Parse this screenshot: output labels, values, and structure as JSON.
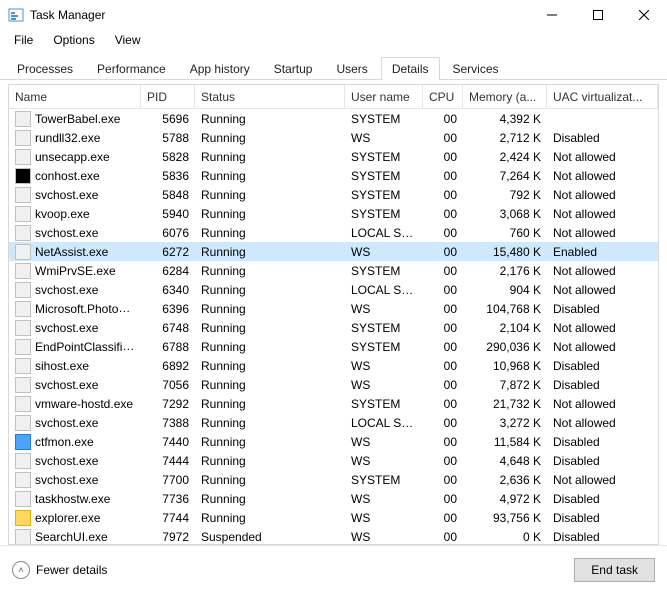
{
  "window": {
    "title": "Task Manager"
  },
  "menu": {
    "file": "File",
    "options": "Options",
    "view": "View"
  },
  "tabs": {
    "processes": "Processes",
    "performance": "Performance",
    "app_history": "App history",
    "startup": "Startup",
    "users": "Users",
    "details": "Details",
    "services": "Services"
  },
  "columns": {
    "name": "Name",
    "pid": "PID",
    "status": "Status",
    "user": "User name",
    "cpu": "CPU",
    "memory": "Memory (a...",
    "uac": "UAC virtualizat..."
  },
  "rows": [
    {
      "icon": "app",
      "name": "TowerBabel.exe",
      "pid": "5696",
      "status": "Running",
      "user": "SYSTEM",
      "cpu": "00",
      "mem": "4,392 K",
      "uac": ""
    },
    {
      "icon": "app",
      "name": "rundll32.exe",
      "pid": "5788",
      "status": "Running",
      "user": "WS",
      "cpu": "00",
      "mem": "2,712 K",
      "uac": "Disabled"
    },
    {
      "icon": "app",
      "name": "unsecapp.exe",
      "pid": "5828",
      "status": "Running",
      "user": "SYSTEM",
      "cpu": "00",
      "mem": "2,424 K",
      "uac": "Not allowed"
    },
    {
      "icon": "console",
      "name": "conhost.exe",
      "pid": "5836",
      "status": "Running",
      "user": "SYSTEM",
      "cpu": "00",
      "mem": "7,264 K",
      "uac": "Not allowed"
    },
    {
      "icon": "app",
      "name": "svchost.exe",
      "pid": "5848",
      "status": "Running",
      "user": "SYSTEM",
      "cpu": "00",
      "mem": "792 K",
      "uac": "Not allowed"
    },
    {
      "icon": "app",
      "name": "kvoop.exe",
      "pid": "5940",
      "status": "Running",
      "user": "SYSTEM",
      "cpu": "00",
      "mem": "3,068 K",
      "uac": "Not allowed"
    },
    {
      "icon": "app",
      "name": "svchost.exe",
      "pid": "6076",
      "status": "Running",
      "user": "LOCAL SE...",
      "cpu": "00",
      "mem": "760 K",
      "uac": "Not allowed"
    },
    {
      "icon": "app",
      "name": "NetAssist.exe",
      "pid": "6272",
      "status": "Running",
      "user": "WS",
      "cpu": "00",
      "mem": "15,480 K",
      "uac": "Enabled",
      "selected": true
    },
    {
      "icon": "app",
      "name": "WmiPrvSE.exe",
      "pid": "6284",
      "status": "Running",
      "user": "SYSTEM",
      "cpu": "00",
      "mem": "2,176 K",
      "uac": "Not allowed"
    },
    {
      "icon": "app",
      "name": "svchost.exe",
      "pid": "6340",
      "status": "Running",
      "user": "LOCAL SE...",
      "cpu": "00",
      "mem": "904 K",
      "uac": "Not allowed"
    },
    {
      "icon": "app",
      "name": "Microsoft.Photos.exe",
      "pid": "6396",
      "status": "Running",
      "user": "WS",
      "cpu": "00",
      "mem": "104,768 K",
      "uac": "Disabled"
    },
    {
      "icon": "app",
      "name": "svchost.exe",
      "pid": "6748",
      "status": "Running",
      "user": "SYSTEM",
      "cpu": "00",
      "mem": "2,104 K",
      "uac": "Not allowed"
    },
    {
      "icon": "app",
      "name": "EndPointClassifier.exe",
      "pid": "6788",
      "status": "Running",
      "user": "SYSTEM",
      "cpu": "00",
      "mem": "290,036 K",
      "uac": "Not allowed"
    },
    {
      "icon": "app",
      "name": "sihost.exe",
      "pid": "6892",
      "status": "Running",
      "user": "WS",
      "cpu": "00",
      "mem": "10,968 K",
      "uac": "Disabled"
    },
    {
      "icon": "app",
      "name": "svchost.exe",
      "pid": "7056",
      "status": "Running",
      "user": "WS",
      "cpu": "00",
      "mem": "7,872 K",
      "uac": "Disabled"
    },
    {
      "icon": "app",
      "name": "vmware-hostd.exe",
      "pid": "7292",
      "status": "Running",
      "user": "SYSTEM",
      "cpu": "00",
      "mem": "21,732 K",
      "uac": "Not allowed"
    },
    {
      "icon": "app",
      "name": "svchost.exe",
      "pid": "7388",
      "status": "Running",
      "user": "LOCAL SE...",
      "cpu": "00",
      "mem": "3,272 K",
      "uac": "Not allowed"
    },
    {
      "icon": "blue",
      "name": "ctfmon.exe",
      "pid": "7440",
      "status": "Running",
      "user": "WS",
      "cpu": "00",
      "mem": "11,584 K",
      "uac": "Disabled"
    },
    {
      "icon": "app",
      "name": "svchost.exe",
      "pid": "7444",
      "status": "Running",
      "user": "WS",
      "cpu": "00",
      "mem": "4,648 K",
      "uac": "Disabled"
    },
    {
      "icon": "app",
      "name": "svchost.exe",
      "pid": "7700",
      "status": "Running",
      "user": "SYSTEM",
      "cpu": "00",
      "mem": "2,636 K",
      "uac": "Not allowed"
    },
    {
      "icon": "app",
      "name": "taskhostw.exe",
      "pid": "7736",
      "status": "Running",
      "user": "WS",
      "cpu": "00",
      "mem": "4,972 K",
      "uac": "Disabled"
    },
    {
      "icon": "yellow",
      "name": "explorer.exe",
      "pid": "7744",
      "status": "Running",
      "user": "WS",
      "cpu": "00",
      "mem": "93,756 K",
      "uac": "Disabled"
    },
    {
      "icon": "app",
      "name": "SearchUI.exe",
      "pid": "7972",
      "status": "Suspended",
      "user": "WS",
      "cpu": "00",
      "mem": "0 K",
      "uac": "Disabled"
    }
  ],
  "footer": {
    "fewer": "Fewer details",
    "endtask": "End task"
  }
}
